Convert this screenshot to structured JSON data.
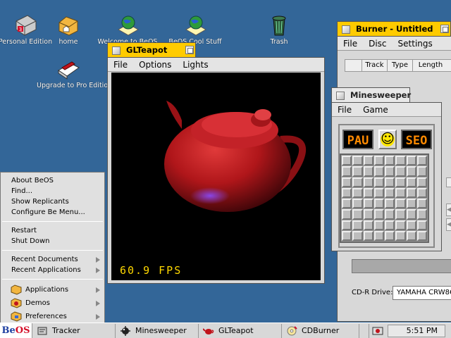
{
  "desktop": {
    "icons": [
      {
        "label": "Personal Edition"
      },
      {
        "label": "home"
      },
      {
        "label": "Welcome to BeOS"
      },
      {
        "label": "BeOS Cool Stuff"
      },
      {
        "label": "Trash"
      },
      {
        "label": "Upgrade to Pro Edition"
      }
    ]
  },
  "glteapot": {
    "title": "GLTeapot",
    "menus": [
      "File",
      "Options",
      "Lights"
    ],
    "fps": "60.9 FPS"
  },
  "burner": {
    "title": "Burner - Untitled",
    "menus": [
      "File",
      "Disc",
      "Settings"
    ],
    "columns": [
      "Track",
      "Type",
      "Length"
    ],
    "drive_label": "CD-R Drive:",
    "drive_value": "YAMAHA CRW86"
  },
  "minesweeper": {
    "title": "Minesweeper",
    "menus": [
      "File",
      "Game"
    ],
    "left_display": "PAU",
    "right_display": "SEO",
    "face": "☺"
  },
  "bemenu": {
    "items": [
      "About BeOS",
      "Find...",
      "Show Replicants",
      "Configure Be Menu..."
    ],
    "session": [
      "Restart",
      "Shut Down"
    ],
    "recent": [
      "Recent Documents",
      "Recent Applications"
    ],
    "launch": [
      "Applications",
      "Demos",
      "Preferences"
    ]
  },
  "taskbar": {
    "logo_b": "Be",
    "logo_os": "OS",
    "tasks": [
      "Tracker",
      "Minesweeper",
      "GLTeapot",
      "CDBurner"
    ],
    "clock": "5:51 PM"
  },
  "colors": {
    "desktop": "#336698",
    "active_tab": "#ffcb00",
    "teapot": "#b0161a",
    "lcd": "#ff8a00"
  }
}
